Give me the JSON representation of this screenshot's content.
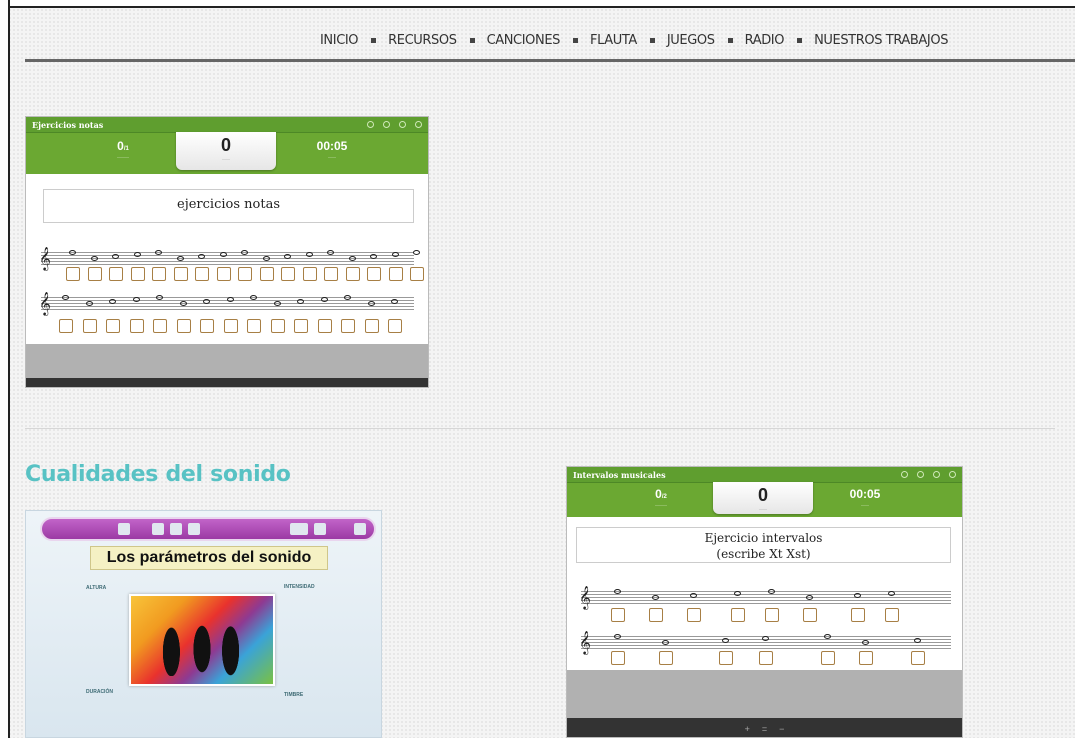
{
  "nav": {
    "items": [
      "INICIO",
      "RECURSOS",
      "CANCIONES",
      "FLAUTA",
      "JUEGOS",
      "RADIO",
      "NUESTROS TRABAJOS"
    ]
  },
  "quiz1": {
    "title": "Ejercicios notas",
    "attempts_value": "0",
    "attempts_total": "/1",
    "score": "0",
    "time": "00:05",
    "question": "ejercicios notas"
  },
  "section": {
    "title": "Cualidades del sonido"
  },
  "sound": {
    "banner": "Los parámetros del sonido",
    "altura": "ALTURA",
    "intensidad": "INTENSIDAD",
    "duracion": "DURACIÓN",
    "timbre": "TIMBRE"
  },
  "quiz2": {
    "title": "Intervalos musicales",
    "attempts_value": "0",
    "attempts_total": "/2",
    "score": "0",
    "time": "00:05",
    "question_line1": "Ejercicio intervalos",
    "question_line2": "(escribe Xt Xst)",
    "footer_controls": [
      "+",
      "=",
      "−"
    ]
  },
  "colors": {
    "quiz_green": "#6ba832",
    "section_title": "#58c2c4",
    "answer_box_border": "#a77f45"
  }
}
